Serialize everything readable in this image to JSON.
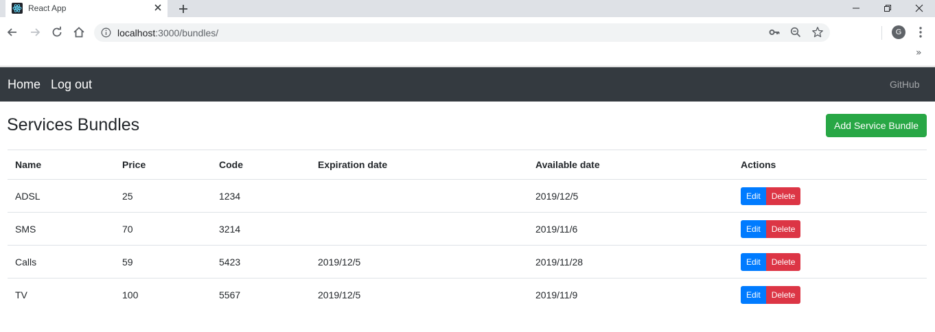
{
  "browser": {
    "tab_title": "React App",
    "url_host": "localhost",
    "url_path": ":3000/bundles/",
    "profile_initial": "G",
    "extensions_chevron": "»"
  },
  "navbar": {
    "home": "Home",
    "logout": "Log out",
    "github": "GitHub"
  },
  "page": {
    "title": "Services Bundles",
    "add_button": "Add Service Bundle"
  },
  "table": {
    "headers": [
      "Name",
      "Price",
      "Code",
      "Expiration date",
      "Available date",
      "Actions"
    ],
    "rows": [
      {
        "name": "ADSL",
        "price": "25",
        "code": "1234",
        "expiration": "",
        "available": "2019/12/5"
      },
      {
        "name": "SMS",
        "price": "70",
        "code": "3214",
        "expiration": "",
        "available": "2019/11/6"
      },
      {
        "name": "Calls",
        "price": "59",
        "code": "5423",
        "expiration": "2019/12/5",
        "available": "2019/11/28"
      },
      {
        "name": "TV",
        "price": "100",
        "code": "5567",
        "expiration": "2019/12/5",
        "available": "2019/11/9"
      }
    ],
    "edit_label": "Edit",
    "delete_label": "Delete"
  },
  "colors": {
    "navbar_bg": "#343a40",
    "add_button": "#28a745",
    "edit_button": "#007bff",
    "delete_button": "#dc3545"
  },
  "icons": [
    "react-logo-icon",
    "close-icon",
    "plus-icon",
    "minimize-icon",
    "maximize-icon",
    "back-icon",
    "forward-icon",
    "reload-icon",
    "home-icon",
    "info-icon",
    "key-icon",
    "zoom-icon",
    "star-icon",
    "kebab-menu-icon"
  ]
}
